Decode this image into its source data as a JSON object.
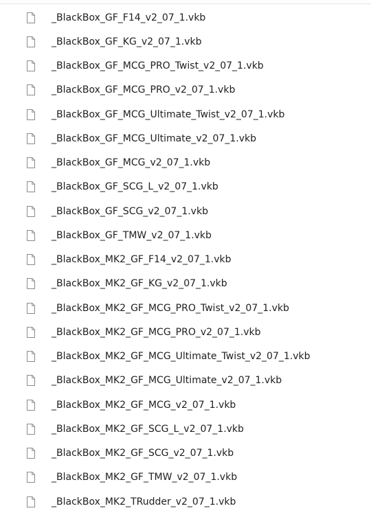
{
  "files": [
    {
      "name": "_BlackBox_GF_F14_v2_07_1.vkb",
      "icon": "file-icon"
    },
    {
      "name": "_BlackBox_GF_KG_v2_07_1.vkb",
      "icon": "file-icon"
    },
    {
      "name": "_BlackBox_GF_MCG_PRO_Twist_v2_07_1.vkb",
      "icon": "file-icon"
    },
    {
      "name": "_BlackBox_GF_MCG_PRO_v2_07_1.vkb",
      "icon": "file-icon"
    },
    {
      "name": "_BlackBox_GF_MCG_Ultimate_Twist_v2_07_1.vkb",
      "icon": "file-icon"
    },
    {
      "name": "_BlackBox_GF_MCG_Ultimate_v2_07_1.vkb",
      "icon": "file-icon"
    },
    {
      "name": "_BlackBox_GF_MCG_v2_07_1.vkb",
      "icon": "file-icon"
    },
    {
      "name": "_BlackBox_GF_SCG_L_v2_07_1.vkb",
      "icon": "file-icon"
    },
    {
      "name": "_BlackBox_GF_SCG_v2_07_1.vkb",
      "icon": "file-icon"
    },
    {
      "name": "_BlackBox_GF_TMW_v2_07_1.vkb",
      "icon": "file-icon"
    },
    {
      "name": "_BlackBox_MK2_GF_F14_v2_07_1.vkb",
      "icon": "file-icon"
    },
    {
      "name": "_BlackBox_MK2_GF_KG_v2_07_1.vkb",
      "icon": "file-icon"
    },
    {
      "name": "_BlackBox_MK2_GF_MCG_PRO_Twist_v2_07_1.vkb",
      "icon": "file-icon"
    },
    {
      "name": "_BlackBox_MK2_GF_MCG_PRO_v2_07_1.vkb",
      "icon": "file-icon"
    },
    {
      "name": "_BlackBox_MK2_GF_MCG_Ultimate_Twist_v2_07_1.vkb",
      "icon": "file-icon"
    },
    {
      "name": "_BlackBox_MK2_GF_MCG_Ultimate_v2_07_1.vkb",
      "icon": "file-icon"
    },
    {
      "name": "_BlackBox_MK2_GF_MCG_v2_07_1.vkb",
      "icon": "file-icon"
    },
    {
      "name": "_BlackBox_MK2_GF_SCG_L_v2_07_1.vkb",
      "icon": "file-icon"
    },
    {
      "name": "_BlackBox_MK2_GF_SCG_v2_07_1.vkb",
      "icon": "file-icon"
    },
    {
      "name": "_BlackBox_MK2_GF_TMW_v2_07_1.vkb",
      "icon": "file-icon"
    },
    {
      "name": "_BlackBox_MK2_TRudder_v2_07_1.vkb",
      "icon": "file-icon"
    }
  ],
  "colors": {
    "icon_stroke": "#8a8a8a",
    "text": "#202020"
  }
}
